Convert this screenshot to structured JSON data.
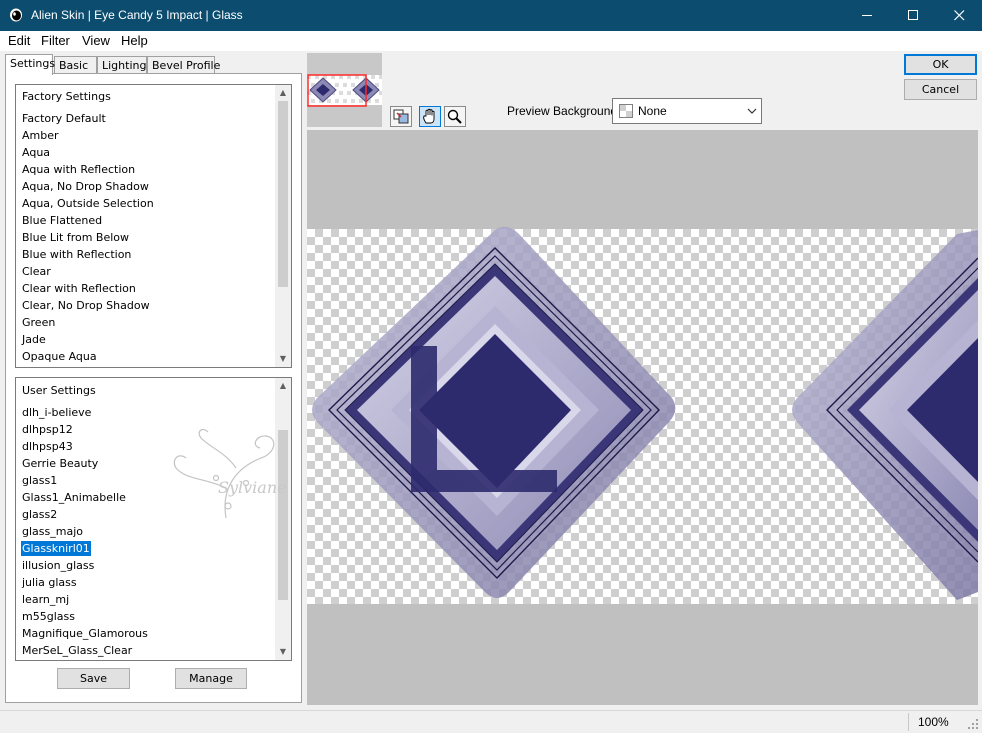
{
  "window": {
    "title": "Alien Skin | Eye Candy 5 Impact | Glass"
  },
  "menu": {
    "edit": "Edit",
    "filter": "Filter",
    "view": "View",
    "help": "Help"
  },
  "tabs": [
    {
      "label": "Settings",
      "active": true
    },
    {
      "label": "Basic"
    },
    {
      "label": "Lighting"
    },
    {
      "label": "Bevel Profile"
    }
  ],
  "factory": {
    "header": "Factory Settings",
    "items": [
      "Factory Default",
      "Amber",
      "Aqua",
      "Aqua with Reflection",
      "Aqua, No Drop Shadow",
      "Aqua, Outside Selection",
      "Blue Flattened",
      "Blue Lit from Below",
      "Blue with Reflection",
      "Clear",
      "Clear with Reflection",
      "Clear, No Drop Shadow",
      "Green",
      "Jade",
      "Opaque Aqua"
    ]
  },
  "user": {
    "header": "User Settings",
    "items": [
      "dlh_i-believe",
      "dlhpsp12",
      "dlhpsp43",
      "Gerrie Beauty",
      "glass1",
      "Glass1_Animabelle",
      "glass2",
      "glass_majo",
      "Glassknirl01",
      "illusion_glass",
      "julia glass",
      "learn_mj",
      "m55glass",
      "Magnifique_Glamorous",
      "MerSeL_Glass_Clear"
    ],
    "selected_index": 8
  },
  "buttons": {
    "save": "Save",
    "manage": "Manage",
    "ok": "OK",
    "cancel": "Cancel"
  },
  "preview": {
    "background_label": "Preview Background:",
    "background_value": "None"
  },
  "watermark": "Sylviane",
  "status": {
    "zoom": "100%"
  },
  "colors": {
    "titlebar": "#0b4c6f",
    "selection": "#0078d7",
    "glass_dark": "#2e2a6e",
    "glass_light": "#a9a6c8"
  }
}
